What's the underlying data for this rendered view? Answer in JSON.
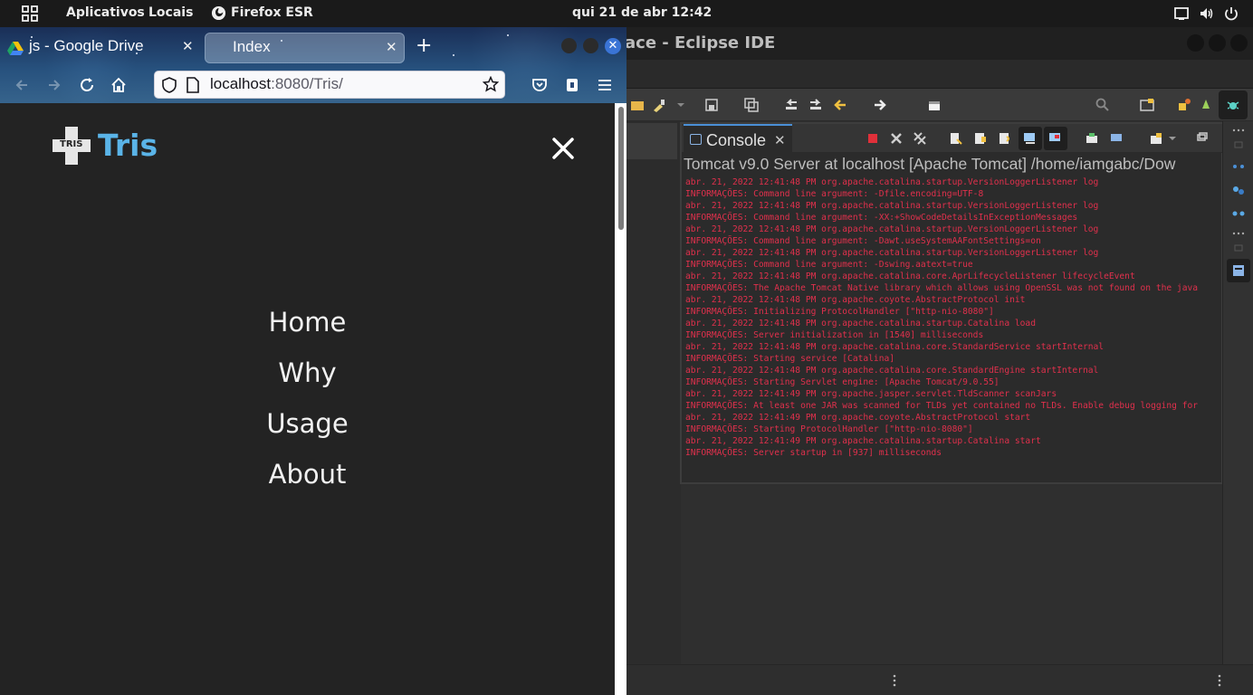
{
  "topbar": {
    "apps_label": "Aplicativos",
    "places_label": "Locais",
    "app_name": "Firefox ESR",
    "clock": "qui 21 de abr  12:42"
  },
  "eclipse": {
    "window_title": "ace - Eclipse IDE",
    "console": {
      "tab_label": "Console",
      "header": "Tomcat v9.0 Server at localhost [Apache Tomcat] /home/iamgabc/Dow",
      "log_color": "#e0304c",
      "lines": [
        "abr. 21, 2022 12:41:48 PM org.apache.catalina.startup.VersionLoggerListener log",
        "INFORMAÇÕES: Command line argument: -Dfile.encoding=UTF-8",
        "abr. 21, 2022 12:41:48 PM org.apache.catalina.startup.VersionLoggerListener log",
        "INFORMAÇÕES: Command line argument: -XX:+ShowCodeDetailsInExceptionMessages",
        "abr. 21, 2022 12:41:48 PM org.apache.catalina.startup.VersionLoggerListener log",
        "INFORMAÇÕES: Command line argument: -Dawt.useSystemAAFontSettings=on",
        "abr. 21, 2022 12:41:48 PM org.apache.catalina.startup.VersionLoggerListener log",
        "INFORMAÇÕES: Command line argument: -Dswing.aatext=true",
        "abr. 21, 2022 12:41:48 PM org.apache.catalina.core.AprLifecycleListener lifecycleEvent",
        "INFORMAÇÕES: The Apache Tomcat Native library which allows using OpenSSL was not found on the java",
        "abr. 21, 2022 12:41:48 PM org.apache.coyote.AbstractProtocol init",
        "INFORMAÇÕES: Initializing ProtocolHandler [\"http-nio-8080\"]",
        "abr. 21, 2022 12:41:48 PM org.apache.catalina.startup.Catalina load",
        "INFORMAÇÕES: Server initialization in [1540] milliseconds",
        "abr. 21, 2022 12:41:48 PM org.apache.catalina.core.StandardService startInternal",
        "INFORMAÇÕES: Starting service [Catalina]",
        "abr. 21, 2022 12:41:48 PM org.apache.catalina.core.StandardEngine startInternal",
        "INFORMAÇÕES: Starting Servlet engine: [Apache Tomcat/9.0.55]",
        "abr. 21, 2022 12:41:49 PM org.apache.jasper.servlet.TldScanner scanJars",
        "INFORMAÇÕES: At least one JAR was scanned for TLDs yet contained no TLDs. Enable debug logging for",
        "abr. 21, 2022 12:41:49 PM org.apache.coyote.AbstractProtocol start",
        "INFORMAÇÕES: Starting ProtocolHandler [\"http-nio-8080\"]",
        "abr. 21, 2022 12:41:49 PM org.apache.catalina.startup.Catalina start",
        "INFORMAÇÕES: Server startup in [937] milliseconds"
      ]
    }
  },
  "firefox": {
    "tabs": [
      {
        "label": "js - Google Drive",
        "icon": "google-drive-icon",
        "active": false
      },
      {
        "label": "Index",
        "icon": "none",
        "active": true
      }
    ],
    "url_host": "localhost",
    "url_rest": ":8080/Tris/",
    "accent_close": "#3a74d6"
  },
  "page": {
    "logo_badge": "TRIS",
    "logo_text": "Tris",
    "logo_color": "#5ab4e8",
    "nav": [
      "Home",
      "Why",
      "Usage",
      "About"
    ]
  }
}
